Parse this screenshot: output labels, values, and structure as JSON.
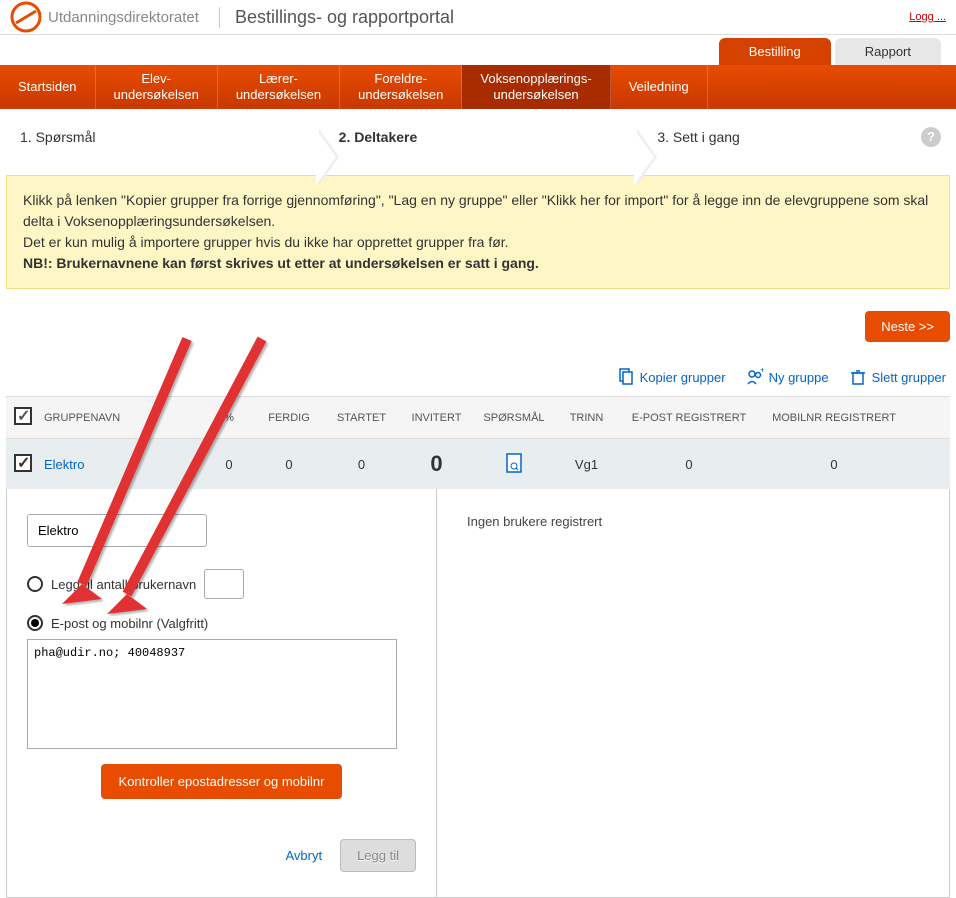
{
  "header": {
    "org_name": "Utdanningsdirektoratet",
    "portal_title": "Bestillings- og rapportportal",
    "logg_link": "Logg ..."
  },
  "top_tabs": {
    "bestilling": "Bestilling",
    "rapport": "Rapport"
  },
  "nav": {
    "startsiden": "Startsiden",
    "elev": "Elev-\nundersøkelsen",
    "laerer": "Lærer-\nundersøkelsen",
    "foreldre": "Foreldre-\nundersøkelsen",
    "voksen": "Voksenopplærings-\nundersøkelsen",
    "veiledning": "Veiledning"
  },
  "steps": {
    "s1": "1. Spørsmål",
    "s2": "2. Deltakere",
    "s3": "3. Sett i gang",
    "help": "?"
  },
  "info": {
    "line1": "Klikk på lenken \"Kopier grupper fra forrige gjennomføring\", \"Lag en ny gruppe\" eller \"Klikk her for import\" for å legge inn de elevgruppene som skal delta i Voksenopplæringsundersøkelsen.",
    "line2": "Det er kun mulig å importere grupper hvis du ikke har opprettet grupper fra før.",
    "line3": "NB!: Brukernavnene kan først skrives ut etter at undersøkelsen er satt i gang."
  },
  "buttons": {
    "neste": "Neste >>",
    "kopier": "Kopier grupper",
    "ny": "Ny gruppe",
    "slett": "Slett grupper",
    "kontroller": "Kontroller epostadresser og mobilnr",
    "avbryt": "Avbryt",
    "leggtil": "Legg til"
  },
  "table": {
    "headers": {
      "gruppenavn": "GRUPPENAVN",
      "pct": "%",
      "ferdig": "FERDIG",
      "startet": "STARTET",
      "invitert": "INVITERT",
      "sporsmal": "SPØRSMÅL",
      "trinn": "TRINN",
      "epost": "E-POST REGISTRERT",
      "mobil": "MOBILNR REGISTRERT"
    },
    "row": {
      "name": "Elektro",
      "pct": "0",
      "ferdig": "0",
      "startet": "0",
      "invitert": "0",
      "trinn": "Vg1",
      "epost": "0",
      "mobil": "0"
    }
  },
  "form": {
    "group_name_value": "Elektro",
    "radio1_label": "Legg til antall brukernavn",
    "radio2_label": "E-post og mobilnr (Valgfritt)",
    "textarea_value": "pha@udir.no; 40048937"
  },
  "right_panel": {
    "no_users": "Ingen brukere registrert"
  }
}
